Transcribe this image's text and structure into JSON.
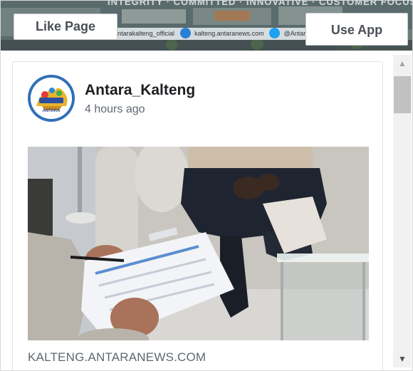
{
  "cover": {
    "motto": "INTEGRITY · COMMITTED · INNOVATIVE · CUSTOMER FOCUS",
    "social_handle_ig": "@antarakalteng_official",
    "social_site": "kalteng.antaranews.com",
    "social_handle_tw": "@Antara"
  },
  "buttons": {
    "like_page": "Like Page",
    "use_app": "Use App"
  },
  "post": {
    "page_name": "Antara_Kalteng",
    "time": "4 hours ago",
    "link_domain": "KALTENG.ANTARANEWS.COM",
    "avatar_brand": "ANTARA"
  },
  "scrollbar": {
    "up_icon": "▲",
    "down_icon": "▼"
  },
  "colors": {
    "avatar_ring": "#2f6fb8",
    "text_primary": "#1c1e21",
    "text_secondary": "#606770"
  }
}
